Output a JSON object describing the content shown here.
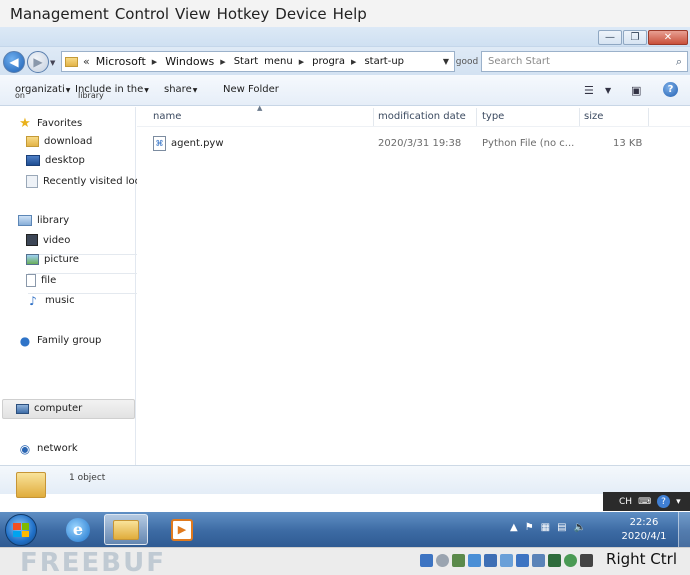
{
  "vm_menu": [
    "Management",
    "Control",
    "View",
    "Hotkey",
    "Device",
    "Help"
  ],
  "window": {
    "buttons": {
      "minimize": "—",
      "restore": "❐",
      "close": "✕"
    }
  },
  "address": {
    "prefix": "«",
    "crumbs": [
      "Microsoft",
      "Windows",
      "Start menu",
      "programs",
      "start-up"
    ],
    "crumb_start_line1": "Start",
    "crumb_start_line2": "menu",
    "crumb_menu": "menu",
    "crumb_progra": "progra",
    "crumb_progra_sub": "m",
    "crumb_startup": "start-up",
    "go_label": "good",
    "search_placeholder": "Search Start"
  },
  "toolbar": {
    "organize": "organizati",
    "organize_sub": "on",
    "include": "Include in the",
    "include_sub": "library",
    "share": "share",
    "new_folder": "New Folder"
  },
  "sidebar": {
    "favorites": "Favorites",
    "download": "download",
    "desktop": "desktop",
    "recent": "Recently visited location",
    "library": "library",
    "video": "video",
    "picture": "picture",
    "file": "file",
    "music": "music",
    "family_group": "Family group",
    "computer": "computer",
    "network": "network"
  },
  "columns": {
    "name": "name",
    "modified": "modification date",
    "type": "type",
    "size": "size"
  },
  "files": [
    {
      "name": "agent.pyw",
      "modified": "2020/3/31 19:38",
      "type": "Python File (no c...",
      "size": "13 KB"
    }
  ],
  "details": {
    "count": "1 object"
  },
  "guest_bar": {
    "lang": "CH"
  },
  "taskbar": {
    "time": "22:26",
    "date": "2020/4/1"
  },
  "vm_status": {
    "watermark": "FREEBUF",
    "host_key": "Right Ctrl"
  },
  "colors": {
    "accent": "#3c6aa3",
    "selection": "#e2e2e2"
  }
}
